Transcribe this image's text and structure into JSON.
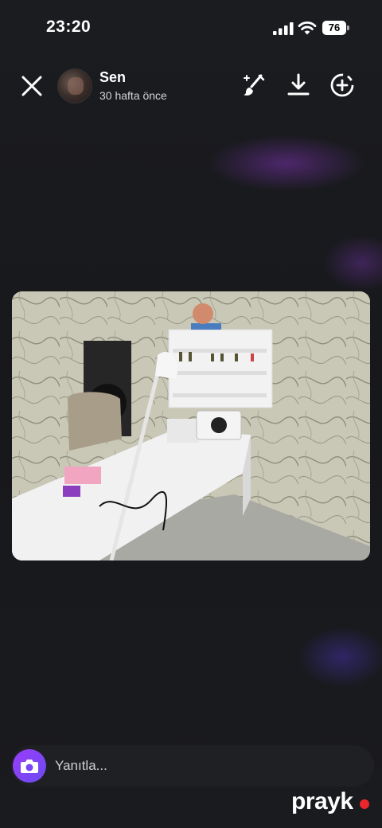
{
  "status_bar": {
    "time": "23:20",
    "battery": "76"
  },
  "header": {
    "username": "Sen",
    "time_ago": "30 hafta önce"
  },
  "story": {
    "image_description": ""
  },
  "reply": {
    "placeholder": "Yanıtla..."
  },
  "watermark": {
    "text": "prayk"
  },
  "colors": {
    "accent": "#8a44f6",
    "background": "#17181c",
    "watermark_dot": "#e8262c"
  },
  "icons": [
    "close-icon",
    "brush-icon",
    "download-icon",
    "add-circle-icon",
    "camera-icon",
    "signal-icon",
    "wifi-icon",
    "battery-icon"
  ]
}
